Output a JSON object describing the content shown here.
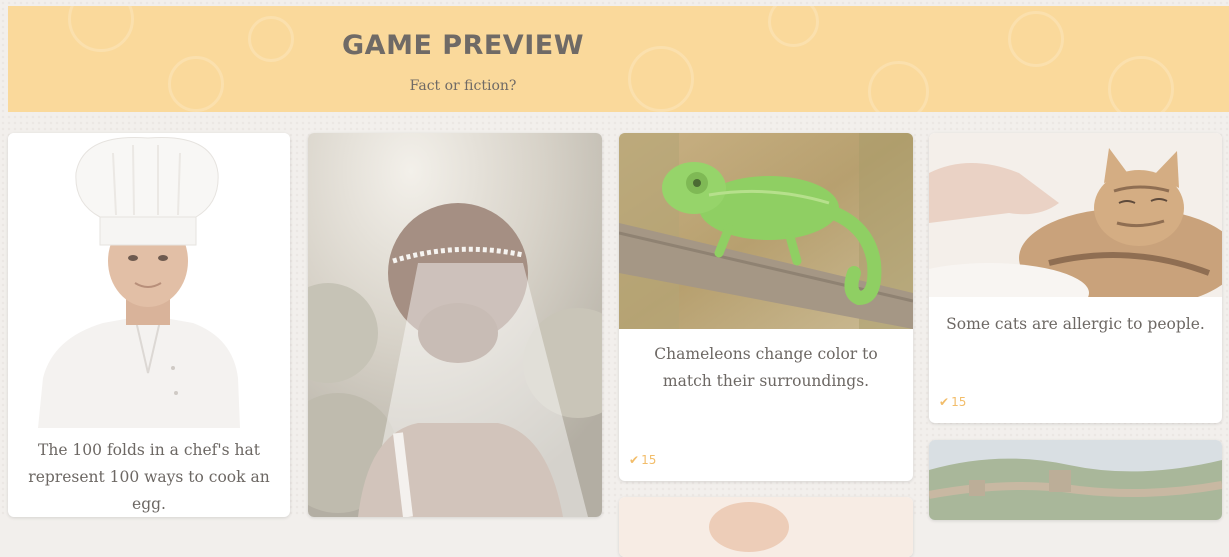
{
  "header": {
    "title": "GAME PREVIEW",
    "subtitle": "Fact or fiction?"
  },
  "colors": {
    "header_bg": "#fad99b",
    "page_bg": "#f2efec",
    "text": "#6d6864",
    "vote_accent": "#f2bd6a"
  },
  "cards": [
    {
      "image": "chef-icon",
      "fact": "The 100 folds in a chef's hat represent 100 ways to cook an egg."
    },
    {
      "image": "bride-icon",
      "fact": ""
    },
    {
      "image": "chameleon-icon",
      "fact": "Chameleons change color to match their surroundings.",
      "votes": "15"
    },
    {
      "image": "cat-icon",
      "fact": "Some cats are allergic to people.",
      "votes": "15"
    },
    {
      "image": "baby-icon",
      "fact": ""
    },
    {
      "image": "great-wall-icon",
      "fact": ""
    }
  ]
}
